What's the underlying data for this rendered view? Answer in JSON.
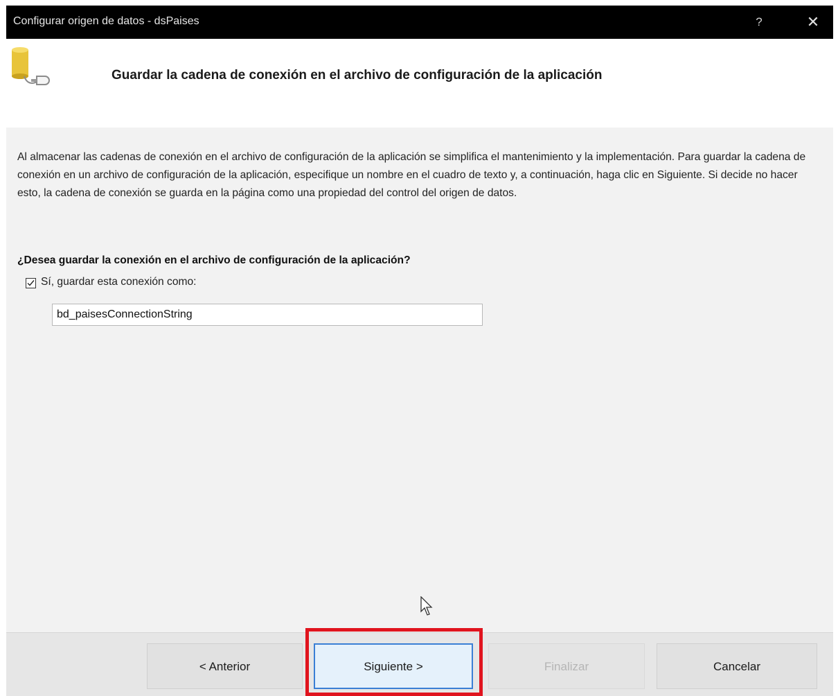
{
  "window": {
    "title": "Configurar origen de datos - dsPaises",
    "help_label": "?",
    "close_label": "✕"
  },
  "header": {
    "title": "Guardar la cadena de conexión en el archivo de configuración de la aplicación",
    "icon": "database-connection-icon"
  },
  "body": {
    "description": "Al almacenar las cadenas de conexión en el archivo de configuración de la aplicación se simplifica el mantenimiento y la implementación. Para guardar la cadena de conexión en un archivo de configuración de la aplicación, especifique un nombre en el cuadro de texto y, a continuación, haga clic en Siguiente. Si decide no hacer esto, la cadena de conexión se guarda en la página como una propiedad del control del origen de datos.",
    "question": "¿Desea guardar la conexión en el archivo de configuración de la aplicación?",
    "save_checkbox": {
      "label": "Sí, guardar esta conexión como:",
      "checked": true
    },
    "connection_name": "bd_paisesConnectionString"
  },
  "footer": {
    "back_label": "< Anterior",
    "next_label": "Siguiente >",
    "finish_label": "Finalizar",
    "cancel_label": "Cancelar"
  },
  "colors": {
    "titlebar": "#000000",
    "highlight": "#e0141e",
    "focus_border": "#3a7fd5"
  }
}
